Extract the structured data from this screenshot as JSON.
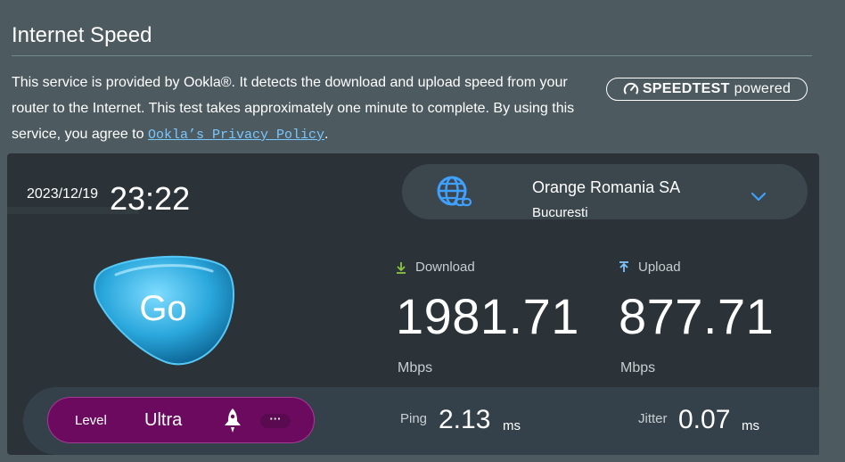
{
  "header": {
    "title": "Internet Speed",
    "description_prefix": "This service is provided by Ookla®. It detects the download and upload speed from your router to the Internet. This test takes approximately one minute to complete. By using this service, you agree to ",
    "privacy_link": "Ookla’s Privacy Policy",
    "description_suffix": ".",
    "badge_brand": "SPEEDTEST",
    "badge_powered": "powered"
  },
  "test": {
    "date": "2023/12/19",
    "time": "23:22",
    "go_label": "Go"
  },
  "server": {
    "name": "Orange Romania SA",
    "city": "Bucuresti"
  },
  "download": {
    "label": "Download",
    "value": "1981.71",
    "unit": "Mbps"
  },
  "upload": {
    "label": "Upload",
    "value": "877.71",
    "unit": "Mbps"
  },
  "ping": {
    "label": "Ping",
    "value": "2.13",
    "unit": "ms"
  },
  "jitter": {
    "label": "Jitter",
    "value": "0.07",
    "unit": "ms"
  },
  "level": {
    "label": "Level",
    "value": "Ultra",
    "more_label": "···"
  },
  "colors": {
    "accent_blue": "#3fa0ff",
    "link_blue": "#79c7ff",
    "download_arrow": "#8cc63f",
    "upload_arrow": "#7fc4ff",
    "level_purple": "#6b0a5f",
    "go_button": "#3fb6e8"
  },
  "icons": {
    "globe": "globe-icon",
    "chevron": "chevron-down-icon",
    "download": "download-arrow-icon",
    "upload": "upload-arrow-icon",
    "rocket": "rocket-icon",
    "speedtest": "speedtest-gauge-icon"
  }
}
